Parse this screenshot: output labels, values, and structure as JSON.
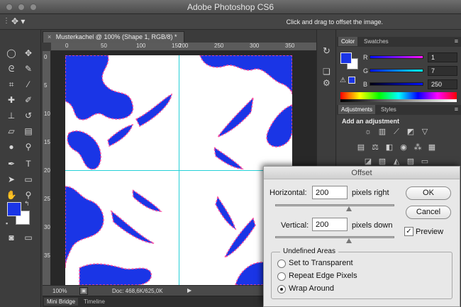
{
  "window": {
    "title": "Adobe Photoshop CS6"
  },
  "options_bar": {
    "hint": "Click and drag to offset the image."
  },
  "document": {
    "tab_title": "Musterkachel @ 100% (Shape 1, RGB/8) *",
    "ruler_h_labels": [
      "0",
      "50",
      "100",
      "150",
      "200",
      "250",
      "300",
      "350"
    ],
    "ruler_v_labels": [
      "0",
      "5",
      "10",
      "15",
      "20",
      "25",
      "30",
      "35"
    ]
  },
  "status": {
    "zoom": "100%",
    "doc": "Doc: 468,6K/625,0K"
  },
  "bottom_tabs": [
    "Mini Bridge",
    "Timeline"
  ],
  "color_panel": {
    "tabs": [
      "Color",
      "Swatches"
    ],
    "r_label": "R",
    "g_label": "G",
    "b_label": "B",
    "r": "1",
    "g": "7",
    "b": "250",
    "foreground": "#1a35e6"
  },
  "adjustments_panel": {
    "tabs": [
      "Adjustments",
      "Styles"
    ],
    "heading": "Add an adjustment"
  },
  "offset_dialog": {
    "title": "Offset",
    "horizontal_label": "Horizontal:",
    "horizontal_value": "200",
    "horizontal_unit": "pixels right",
    "vertical_label": "Vertical:",
    "vertical_value": "200",
    "vertical_unit": "pixels down",
    "ok": "OK",
    "cancel": "Cancel",
    "preview_label": "Preview",
    "preview_checked": true,
    "undefined_areas": {
      "legend": "Undefined Areas",
      "options": [
        "Set to Transparent",
        "Repeat Edge Pixels",
        "Wrap Around"
      ],
      "selected": "Wrap Around"
    }
  },
  "colors": {
    "shape_blue": "#1a35e6",
    "guide": "#25d0d8",
    "marching": "#ff4fa0"
  }
}
